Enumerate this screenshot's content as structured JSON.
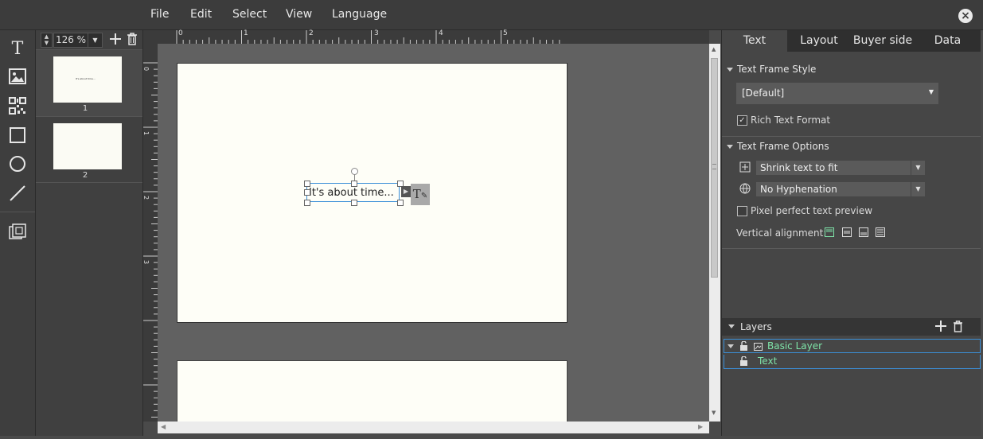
{
  "menu": {
    "items": [
      "File",
      "Edit",
      "Select",
      "View",
      "Language"
    ],
    "close_label": "×"
  },
  "pages_panel": {
    "zoom_value": "126 %",
    "pages": [
      {
        "number": "1",
        "thumb_text": "It's about time..."
      },
      {
        "number": "2"
      }
    ]
  },
  "ruler": {
    "top_numbers": [
      "0",
      "1",
      "2",
      "3",
      "4",
      "5"
    ],
    "left_numbers": [
      "0",
      "1",
      "2",
      "3"
    ]
  },
  "canvas": {
    "text_frame_text": "It's about time...",
    "edit_icon_glyph": "T"
  },
  "right_panel": {
    "tabs": [
      "Text",
      "Layout",
      "Buyer side",
      "Data"
    ],
    "active_tab": "Text",
    "text_frame_style": {
      "title": "Text Frame Style",
      "selected_style": "[Default]",
      "rich_text_label": "Rich Text Format",
      "rich_text_checked": true
    },
    "text_frame_options": {
      "title": "Text Frame Options",
      "fit_option": "Shrink text to fit",
      "hyphenation_option": "No Hyphenation",
      "pixel_perfect_label": "Pixel perfect text preview",
      "pixel_perfect_checked": false,
      "vertical_alignment_label": "Vertical alignment:"
    },
    "layers": {
      "title": "Layers",
      "items": [
        {
          "name": "Basic Layer",
          "level": 0
        },
        {
          "name": "Text",
          "level": 1
        }
      ]
    }
  },
  "colors": {
    "accent_blue": "#3b8fd8",
    "layer_green": "#7ee3a8",
    "page_bg": "#fefef7"
  }
}
